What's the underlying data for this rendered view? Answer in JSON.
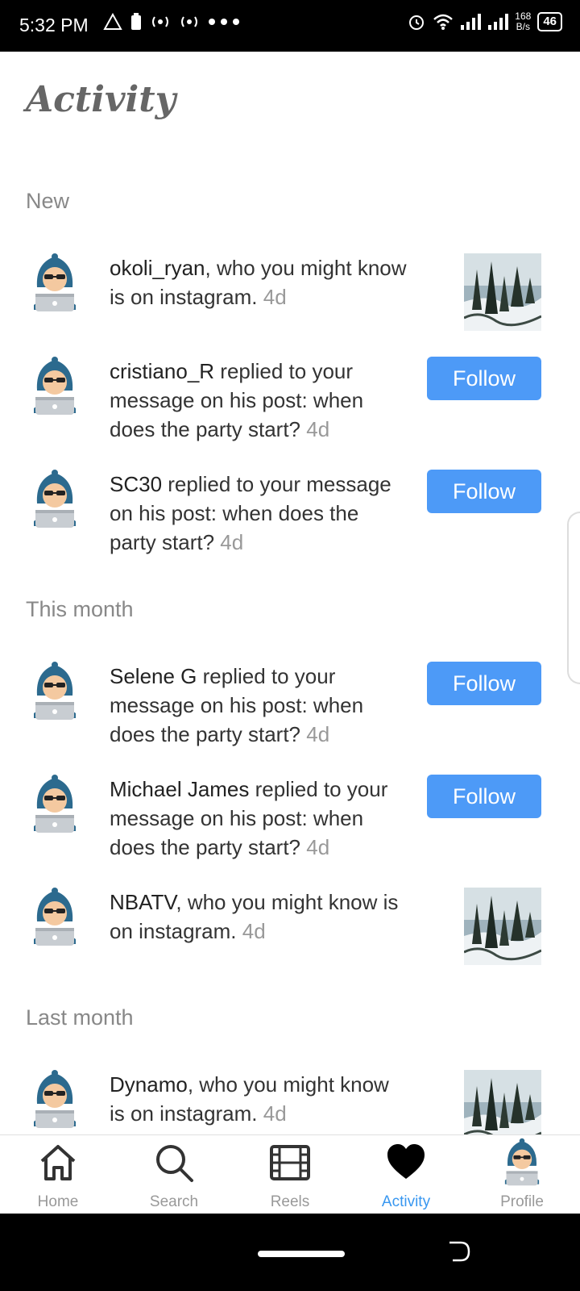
{
  "status_bar": {
    "time": "5:32 PM",
    "net_speed_value": "168",
    "net_speed_unit": "B/s",
    "battery": "46"
  },
  "page": {
    "title": "Activity"
  },
  "sections": [
    {
      "label": "New"
    },
    {
      "label": "This month"
    },
    {
      "label": "Last month"
    }
  ],
  "rows": [
    {
      "username": "okoli_ryan",
      "message": ", who you might know is on instagram.",
      "time": "4d",
      "action": "thumbnail"
    },
    {
      "username": "cristiano_R",
      "message": " replied to your message on his post: when does the party start?",
      "time": "4d",
      "action": "follow",
      "button_label": "Follow"
    },
    {
      "username": "SC30",
      "message": " replied to your message on his post: when does the party start?",
      "time": "4d",
      "action": "follow",
      "button_label": "Follow"
    },
    {
      "username": "Selene G",
      "message": " replied to your message on his post: when does the party start?",
      "time": "4d",
      "action": "follow",
      "button_label": "Follow"
    },
    {
      "username": "Michael James",
      "message": " replied to your message on his post: when does the party start?",
      "time": "4d",
      "action": "follow",
      "button_label": "Follow"
    },
    {
      "username": "NBATV",
      "message": ", who you might know is on instagram.",
      "time": "4d",
      "action": "thumbnail"
    },
    {
      "username": "Dynamo",
      "message": ", who you might know is on instagram.",
      "time": "4d",
      "action": "thumbnail"
    }
  ],
  "bottom_nav": [
    {
      "label": "Home",
      "icon": "home-icon"
    },
    {
      "label": "Search",
      "icon": "search-icon"
    },
    {
      "label": "Reels",
      "icon": "reels-icon"
    },
    {
      "label": "Activity",
      "icon": "heart-icon",
      "active": true
    },
    {
      "label": "Profile",
      "icon": "avatar"
    }
  ],
  "colors": {
    "accent": "#3897f0",
    "follow_button": "#4d9af7"
  }
}
